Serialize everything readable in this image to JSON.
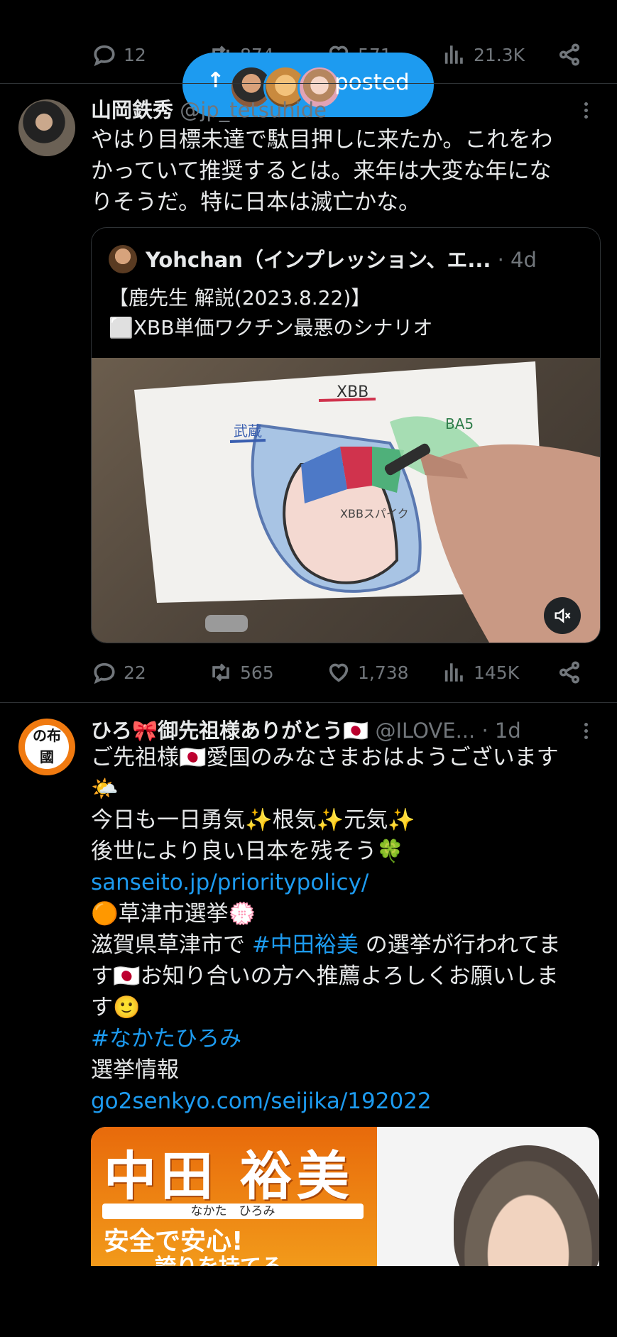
{
  "top_actions": {
    "replies": "12",
    "retweets": "874",
    "likes": "571",
    "views": "21.3K"
  },
  "posted_pill": {
    "label": "posted"
  },
  "tweet1": {
    "author": "山岡鉄秀",
    "handle": "@jp_tetsuhide",
    "text": [
      "やはり目標未達で駄目押しに来たか。これをわ",
      "かっていて推奨するとは。来年は大変な年にな",
      "りそうだ。特に日本は滅亡かな。"
    ],
    "quote": {
      "author": "Yohchan（インプレッション、エ...",
      "time": "· 4d",
      "line1": "【鹿先生 解説(2023.8.22)】",
      "line2": "⬜XBB単価ワクチン最悪のシナリオ"
    },
    "actions": {
      "replies": "22",
      "retweets": "565",
      "likes": "1,738",
      "views": "145K"
    }
  },
  "tweet2": {
    "author": "ひろ🎀御先祖様ありがとう🇯🇵",
    "handle": "@ILOVE...",
    "time": "· 1d",
    "lines": {
      "l1": "ご先祖様🇯🇵愛国のみなさまおはようございます",
      "l2": "🌤️",
      "l3": "今日も一日勇気✨根気✨元気✨",
      "l4": "後世により良い日本を残そう🍀",
      "l5": "sanseito.jp/prioritypolicy/",
      "l6": "🟠草津市選挙💮",
      "l7a": "滋賀県草津市で ",
      "l7b": "#中田裕美",
      "l7c": " の選挙が行われてま",
      "l8": "す🇯🇵お知り合いの方へ推薦よろしくお願いしま",
      "l9": "す🙂",
      "l10": "#なかたひろみ",
      "l11": "選挙情報",
      "l12": "go2senkyo.com/seijika/192022"
    },
    "poster": {
      "name": "中田 裕美",
      "kana": "なかた　ひろみ",
      "slogan1": "安全で安心!",
      "slogan2": "誇りを持てる"
    }
  },
  "drawing_labels": {
    "xbb": "XBB",
    "left": "武蔵",
    "right": "BA5",
    "center": "XBBスパイク"
  },
  "colors": {
    "link": "#1d9bf0",
    "muted": "#71767b",
    "pill": "#1d9bf0",
    "orange": "#f07a10"
  }
}
